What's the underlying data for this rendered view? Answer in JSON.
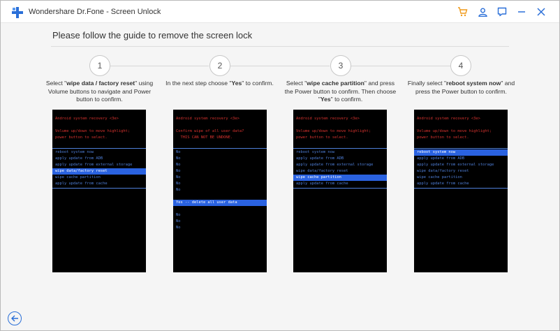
{
  "app": {
    "title": "Wondershare Dr.Fone - Screen Unlock",
    "accent": "#2a6fd8",
    "cart_color": "#f09a1a"
  },
  "headline": "Please follow the guide to remove the screen lock",
  "steps": [
    {
      "number": "1",
      "text_a": "Select \"",
      "bold_a": "wipe data / factory reset",
      "text_b": "\" using Volume buttons to navigate and Power button to confirm.",
      "bold_b": "",
      "text_c": "",
      "screen": {
        "header": "Android system recovery <3e>",
        "instructions": [
          "Volume up/down to move highlight;",
          "power button to select."
        ],
        "items": [
          "reboot system now",
          "apply update from ADB",
          "apply update from external storage",
          "wipe data/factory reset",
          "wipe cache partition",
          "apply update from cache"
        ],
        "selected": 3
      }
    },
    {
      "number": "2",
      "text_a": "In the next step choose \"",
      "bold_a": "Yes",
      "text_b": "\" to confirm.",
      "bold_b": "",
      "text_c": "",
      "screen": {
        "header": "Android system recovery <3e>",
        "instructions": [
          "Confirm wipe of all user data?",
          "  THIS CAN NOT BE UNDONE."
        ],
        "items": [
          "No",
          "No",
          "No",
          "No",
          "No",
          "No",
          "No",
          "Yes -- delete all user data",
          "No",
          "No",
          "No"
        ],
        "selected": 7
      }
    },
    {
      "number": "3",
      "text_a": "Select \"",
      "bold_a": "wipe cache partition",
      "text_b": "\" and press the Power button to confirm. Then choose \"",
      "bold_b": "Yes",
      "text_c": "\" to confirm.",
      "screen": {
        "header": "Android system recovery <3e>",
        "instructions": [
          "Volume up/down to move highlight;",
          "power button to select."
        ],
        "items": [
          "reboot system now",
          "apply update from ADB",
          "apply update from external storage",
          "wipe data/factory reset",
          "wipe cache partition",
          "apply update from cache"
        ],
        "selected": 4
      }
    },
    {
      "number": "4",
      "text_a": "Finally select \"",
      "bold_a": "reboot system now",
      "text_b": "\" and press the Power button to confirm.",
      "bold_b": "",
      "text_c": "",
      "screen": {
        "header": "Android system recovery <3e>",
        "instructions": [
          "Volume up/down to move highlight;",
          "power button to select."
        ],
        "items": [
          "reboot system now",
          "apply update from ADB",
          "apply update from external storage",
          "wipe data/factory reset",
          "wipe cache partition",
          "apply update from cache"
        ],
        "selected": 0
      }
    }
  ],
  "toolbar_icons": [
    "cart-icon",
    "user-icon",
    "feedback-icon",
    "minimize-icon",
    "close-icon"
  ],
  "footer": {
    "back_icon": "back-arrow-icon"
  }
}
